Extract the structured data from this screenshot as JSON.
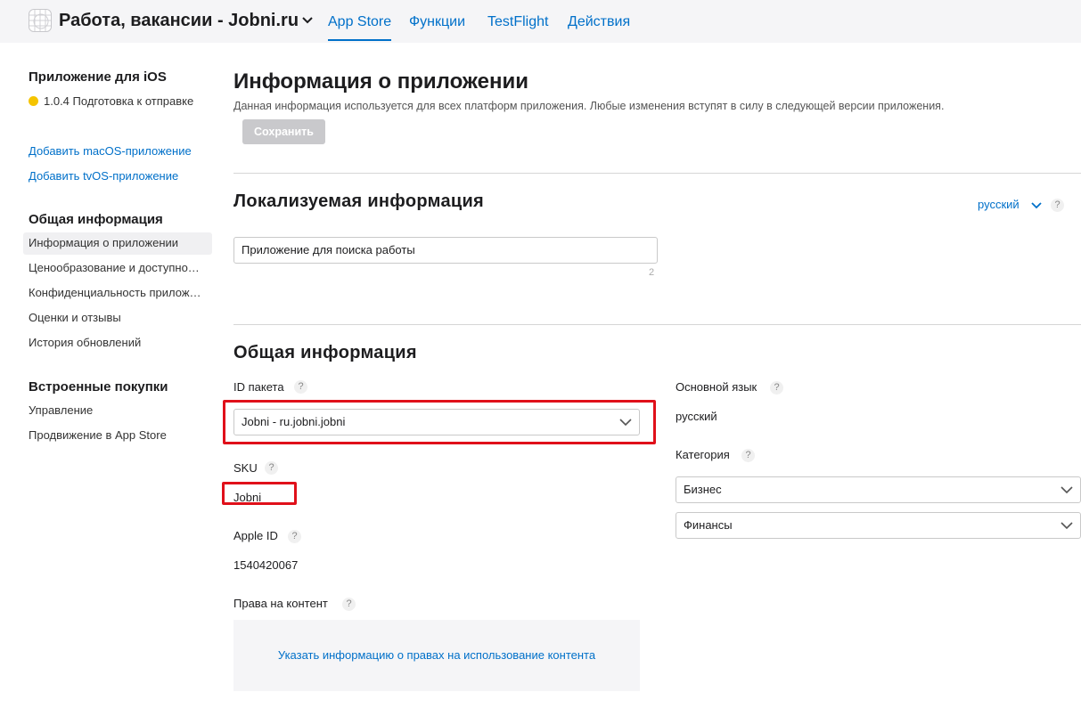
{
  "topbar": {
    "app_title": "Работа, вакансии - Jobni.ru",
    "nav": [
      "App Store",
      "Функции",
      "TestFlight",
      "Действия"
    ],
    "active_tab": "App Store"
  },
  "sidebar": {
    "platform_heading": "Приложение для iOS",
    "version_status": "1.0.4 Подготовка к отправке",
    "add_links": [
      "Добавить macOS-приложение",
      "Добавить tvOS-приложение"
    ],
    "general_heading": "Общая информация",
    "general_items": [
      "Информация о приложении",
      "Ценообразование и доступно…",
      "Конфиденциальность прилож…",
      "Оценки и отзывы",
      "История обновлений"
    ],
    "iap_heading": "Встроенные покупки",
    "iap_items": [
      "Управление",
      "Продвижение в App Store"
    ]
  },
  "main": {
    "title": "Информация о приложении",
    "description": "Данная информация используется для всех платформ приложения. Любые изменения вступят в силу в следующей версии приложения.",
    "save_label": "Сохранить",
    "localizable": {
      "heading": "Локализуемая информация",
      "language": "русский",
      "subtitle_value": "Приложение для поиска работы",
      "char_count": "2"
    },
    "general": {
      "heading": "Общая информация",
      "bundle_id_label": "ID пакета",
      "bundle_id_value": "Jobni - ru.jobni.jobni",
      "sku_label": "SKU",
      "sku_value": "Jobni",
      "apple_id_label": "Apple ID",
      "apple_id_value": "1540420067",
      "content_rights_label": "Права на контент",
      "content_rights_link": "Указать информацию о правах на использование контента",
      "primary_language_label": "Основной язык",
      "primary_language_value": "русский",
      "category_label": "Категория",
      "category_primary": "Бизнес",
      "category_secondary": "Финансы"
    }
  },
  "help_glyph": "?",
  "colors": {
    "link": "#0070c9",
    "highlight": "#e0101a",
    "status_dot": "#f5c400"
  }
}
